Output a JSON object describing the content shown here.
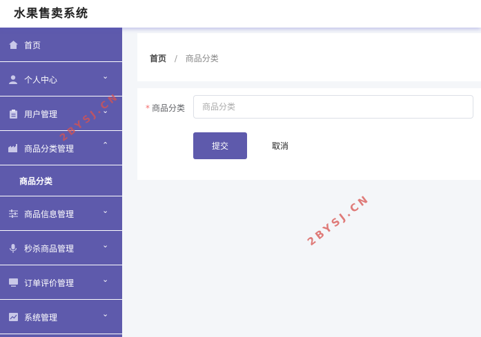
{
  "app": {
    "title": "水果售卖系统"
  },
  "sidebar": {
    "items": [
      {
        "label": "首页",
        "icon": "home-icon",
        "has_chevron": false
      },
      {
        "label": "个人中心",
        "icon": "user-icon",
        "has_chevron": true,
        "chevron": "down"
      },
      {
        "label": "用户管理",
        "icon": "clipboard-icon",
        "has_chevron": true,
        "chevron": "down"
      },
      {
        "label": "商品分类管理",
        "icon": "factory-icon",
        "has_chevron": true,
        "chevron": "up",
        "expanded": true,
        "children": [
          {
            "label": "商品分类"
          }
        ]
      },
      {
        "label": "商品信息管理",
        "icon": "sliders-icon",
        "has_chevron": true,
        "chevron": "down"
      },
      {
        "label": "秒杀商品管理",
        "icon": "microphone-icon",
        "has_chevron": true,
        "chevron": "down"
      },
      {
        "label": "订单评价管理",
        "icon": "monitor-icon",
        "has_chevron": true,
        "chevron": "down"
      },
      {
        "label": "系统管理",
        "icon": "chart-icon",
        "has_chevron": true,
        "chevron": "down"
      }
    ]
  },
  "breadcrumb": {
    "home": "首页",
    "separator": "/",
    "current": "商品分类"
  },
  "form": {
    "label": "商品分类",
    "required_mark": "*",
    "input_value": "",
    "input_placeholder": "商品分类",
    "submit_label": "提交",
    "cancel_label": "取消"
  },
  "watermarks": [
    "2BYSJ.CN",
    "2BYSJ.CN"
  ],
  "colors": {
    "sidebar_bg": "#5e5aac",
    "primary": "#5e5aac",
    "required": "#f56c6c",
    "watermark": "#d9534f"
  }
}
